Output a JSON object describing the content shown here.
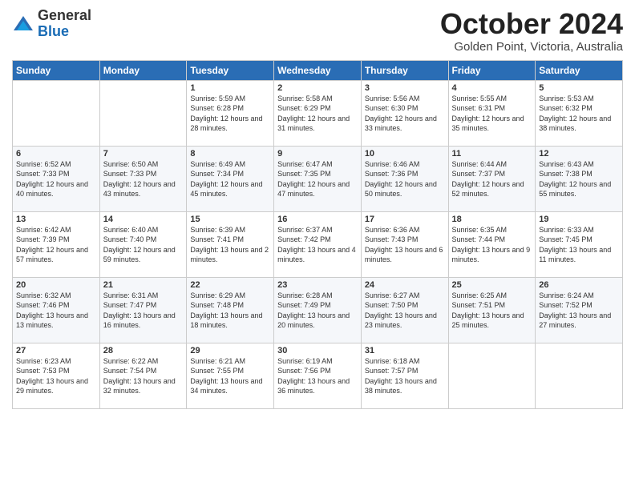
{
  "header": {
    "logo_general": "General",
    "logo_blue": "Blue",
    "title": "October 2024",
    "location": "Golden Point, Victoria, Australia"
  },
  "days_of_week": [
    "Sunday",
    "Monday",
    "Tuesday",
    "Wednesday",
    "Thursday",
    "Friday",
    "Saturday"
  ],
  "weeks": [
    [
      {
        "day": "",
        "info": ""
      },
      {
        "day": "",
        "info": ""
      },
      {
        "day": "1",
        "info": "Sunrise: 5:59 AM\nSunset: 6:28 PM\nDaylight: 12 hours and 28 minutes."
      },
      {
        "day": "2",
        "info": "Sunrise: 5:58 AM\nSunset: 6:29 PM\nDaylight: 12 hours and 31 minutes."
      },
      {
        "day": "3",
        "info": "Sunrise: 5:56 AM\nSunset: 6:30 PM\nDaylight: 12 hours and 33 minutes."
      },
      {
        "day": "4",
        "info": "Sunrise: 5:55 AM\nSunset: 6:31 PM\nDaylight: 12 hours and 35 minutes."
      },
      {
        "day": "5",
        "info": "Sunrise: 5:53 AM\nSunset: 6:32 PM\nDaylight: 12 hours and 38 minutes."
      }
    ],
    [
      {
        "day": "6",
        "info": "Sunrise: 6:52 AM\nSunset: 7:33 PM\nDaylight: 12 hours and 40 minutes."
      },
      {
        "day": "7",
        "info": "Sunrise: 6:50 AM\nSunset: 7:33 PM\nDaylight: 12 hours and 43 minutes."
      },
      {
        "day": "8",
        "info": "Sunrise: 6:49 AM\nSunset: 7:34 PM\nDaylight: 12 hours and 45 minutes."
      },
      {
        "day": "9",
        "info": "Sunrise: 6:47 AM\nSunset: 7:35 PM\nDaylight: 12 hours and 47 minutes."
      },
      {
        "day": "10",
        "info": "Sunrise: 6:46 AM\nSunset: 7:36 PM\nDaylight: 12 hours and 50 minutes."
      },
      {
        "day": "11",
        "info": "Sunrise: 6:44 AM\nSunset: 7:37 PM\nDaylight: 12 hours and 52 minutes."
      },
      {
        "day": "12",
        "info": "Sunrise: 6:43 AM\nSunset: 7:38 PM\nDaylight: 12 hours and 55 minutes."
      }
    ],
    [
      {
        "day": "13",
        "info": "Sunrise: 6:42 AM\nSunset: 7:39 PM\nDaylight: 12 hours and 57 minutes."
      },
      {
        "day": "14",
        "info": "Sunrise: 6:40 AM\nSunset: 7:40 PM\nDaylight: 12 hours and 59 minutes."
      },
      {
        "day": "15",
        "info": "Sunrise: 6:39 AM\nSunset: 7:41 PM\nDaylight: 13 hours and 2 minutes."
      },
      {
        "day": "16",
        "info": "Sunrise: 6:37 AM\nSunset: 7:42 PM\nDaylight: 13 hours and 4 minutes."
      },
      {
        "day": "17",
        "info": "Sunrise: 6:36 AM\nSunset: 7:43 PM\nDaylight: 13 hours and 6 minutes."
      },
      {
        "day": "18",
        "info": "Sunrise: 6:35 AM\nSunset: 7:44 PM\nDaylight: 13 hours and 9 minutes."
      },
      {
        "day": "19",
        "info": "Sunrise: 6:33 AM\nSunset: 7:45 PM\nDaylight: 13 hours and 11 minutes."
      }
    ],
    [
      {
        "day": "20",
        "info": "Sunrise: 6:32 AM\nSunset: 7:46 PM\nDaylight: 13 hours and 13 minutes."
      },
      {
        "day": "21",
        "info": "Sunrise: 6:31 AM\nSunset: 7:47 PM\nDaylight: 13 hours and 16 minutes."
      },
      {
        "day": "22",
        "info": "Sunrise: 6:29 AM\nSunset: 7:48 PM\nDaylight: 13 hours and 18 minutes."
      },
      {
        "day": "23",
        "info": "Sunrise: 6:28 AM\nSunset: 7:49 PM\nDaylight: 13 hours and 20 minutes."
      },
      {
        "day": "24",
        "info": "Sunrise: 6:27 AM\nSunset: 7:50 PM\nDaylight: 13 hours and 23 minutes."
      },
      {
        "day": "25",
        "info": "Sunrise: 6:25 AM\nSunset: 7:51 PM\nDaylight: 13 hours and 25 minutes."
      },
      {
        "day": "26",
        "info": "Sunrise: 6:24 AM\nSunset: 7:52 PM\nDaylight: 13 hours and 27 minutes."
      }
    ],
    [
      {
        "day": "27",
        "info": "Sunrise: 6:23 AM\nSunset: 7:53 PM\nDaylight: 13 hours and 29 minutes."
      },
      {
        "day": "28",
        "info": "Sunrise: 6:22 AM\nSunset: 7:54 PM\nDaylight: 13 hours and 32 minutes."
      },
      {
        "day": "29",
        "info": "Sunrise: 6:21 AM\nSunset: 7:55 PM\nDaylight: 13 hours and 34 minutes."
      },
      {
        "day": "30",
        "info": "Sunrise: 6:19 AM\nSunset: 7:56 PM\nDaylight: 13 hours and 36 minutes."
      },
      {
        "day": "31",
        "info": "Sunrise: 6:18 AM\nSunset: 7:57 PM\nDaylight: 13 hours and 38 minutes."
      },
      {
        "day": "",
        "info": ""
      },
      {
        "day": "",
        "info": ""
      }
    ]
  ]
}
